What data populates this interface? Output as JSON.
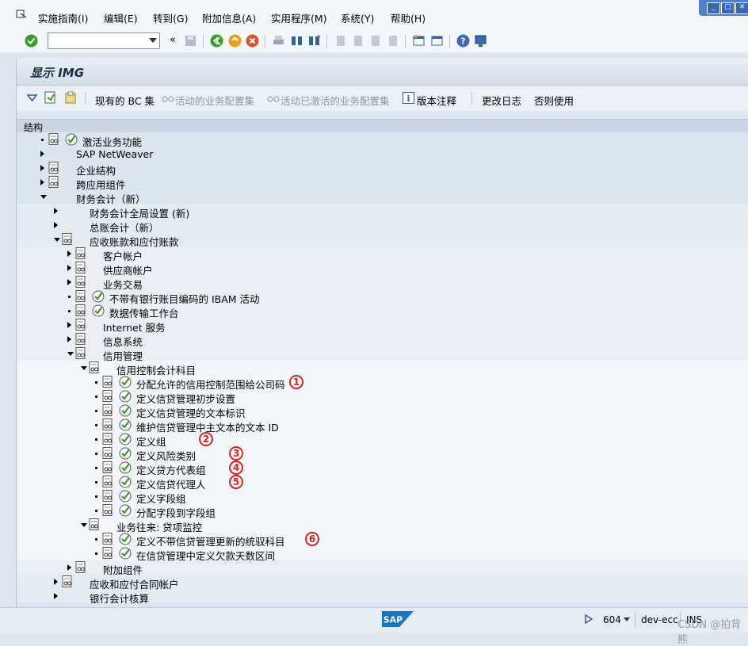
{
  "menu": {
    "items": [
      "实施指南(I)",
      "编辑(E)",
      "转到(G)",
      "附加信息(A)",
      "实用程序(M)",
      "系统(Y)",
      "帮助(H)"
    ]
  },
  "toolbar": {
    "command_value": "",
    "nav_label": "«"
  },
  "window": {
    "title": "显示 IMG"
  },
  "app_toolbar": {
    "bc_sets": "现有的 BC 集",
    "active_bc": "活动的业务配置集",
    "activated_bc": "活动已激活的业务配置集",
    "release_notes": "版本注释",
    "change_log": "更改日志",
    "usage": "否则使用"
  },
  "tree": {
    "header": "结构",
    "rows": [
      {
        "label": "激活业务功能"
      },
      {
        "label": "SAP NetWeaver"
      },
      {
        "label": "企业结构"
      },
      {
        "label": "跨应用组件"
      },
      {
        "label": "财务会计（新）"
      },
      {
        "label": "财务会计全局设置 (新)"
      },
      {
        "label": "总账会计（新）"
      },
      {
        "label": "应收账款和应付账款"
      },
      {
        "label": "客户帐户"
      },
      {
        "label": "供应商帐户"
      },
      {
        "label": "业务交易"
      },
      {
        "label": "不带有银行账目编码的 IBAM 活动"
      },
      {
        "label": "数据传输工作台"
      },
      {
        "label": "Internet 服务"
      },
      {
        "label": "信息系统"
      },
      {
        "label": "信用管理"
      },
      {
        "label": "信用控制会计科目"
      },
      {
        "label": "分配允许的信用控制范围给公司码",
        "marker": "1"
      },
      {
        "label": "定义信贷管理初步设置"
      },
      {
        "label": "定义信贷管理的文本标识"
      },
      {
        "label": "维护信贷管理中主文本的文本 ID"
      },
      {
        "label": "定义组",
        "marker": "2"
      },
      {
        "label": "定义风险类别",
        "marker": "3"
      },
      {
        "label": "定义贷方代表组",
        "marker": "4"
      },
      {
        "label": "定义信贷代理人",
        "marker": "5"
      },
      {
        "label": "定义字段组"
      },
      {
        "label": "分配字段到字段组"
      },
      {
        "label": "业务往来: 贷项监控"
      },
      {
        "label": "定义不带信贷管理更新的统驭科目",
        "marker": "6"
      },
      {
        "label": "在信贷管理中定义欠款天数区间"
      },
      {
        "label": "附加组件"
      },
      {
        "label": "应收和应付合同帐户"
      },
      {
        "label": "银行会计核算"
      }
    ]
  },
  "status": {
    "session": "604",
    "system": "dev-ecc",
    "mode": "INS",
    "watermark": "CSDN @拍背熊"
  },
  "colors": {
    "marker": "#d7261b",
    "check": "#3a9a2a"
  }
}
